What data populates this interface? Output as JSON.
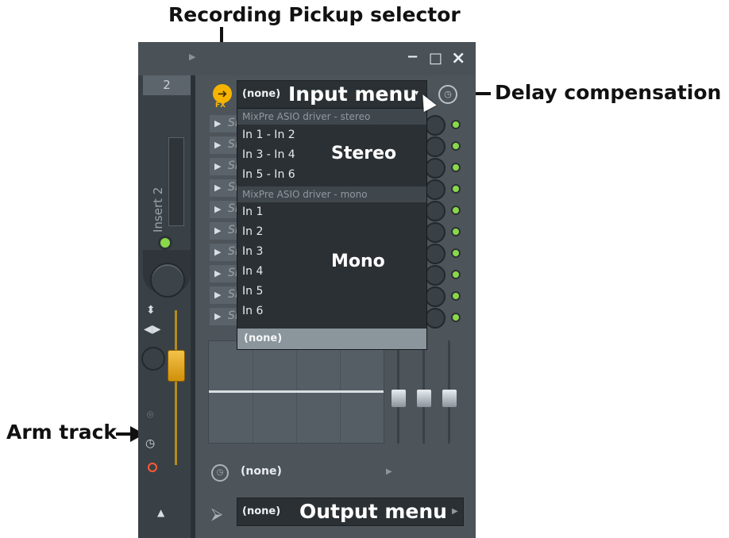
{
  "callouts": {
    "recording_pickup": "Recording Pickup selector",
    "delay_compensation": "Delay compensation",
    "arm_track": "Arm track"
  },
  "window": {
    "minimize": "−",
    "maximize": "□",
    "close": "×"
  },
  "strip": {
    "number": "2",
    "name": "Insert 2"
  },
  "pickup": {
    "badge": "FX"
  },
  "input": {
    "value": "(none)",
    "label": "Input menu",
    "arrow": "▾"
  },
  "slots": {
    "abbr": "Sl",
    "count": 10
  },
  "dropdown": {
    "stereo_header": "MixPre ASIO driver - stereo",
    "stereo_items": [
      "In 1 - In 2",
      "In 3 - In 4",
      "In 5 - In 6"
    ],
    "stereo_label": "Stereo",
    "mono_header": "MixPre ASIO driver - mono",
    "mono_items": [
      "In 1",
      "In 2",
      "In 3",
      "In 4",
      "In 5",
      "In 6"
    ],
    "mono_label": "Mono",
    "none_item": "(none)"
  },
  "delay_row": {
    "value": "(none)"
  },
  "output": {
    "value": "(none)",
    "label": "Output menu"
  },
  "icons": [
    "pickup-icon",
    "clock-icon",
    "output-icon",
    "arm-record-icon",
    "eq-panel"
  ]
}
